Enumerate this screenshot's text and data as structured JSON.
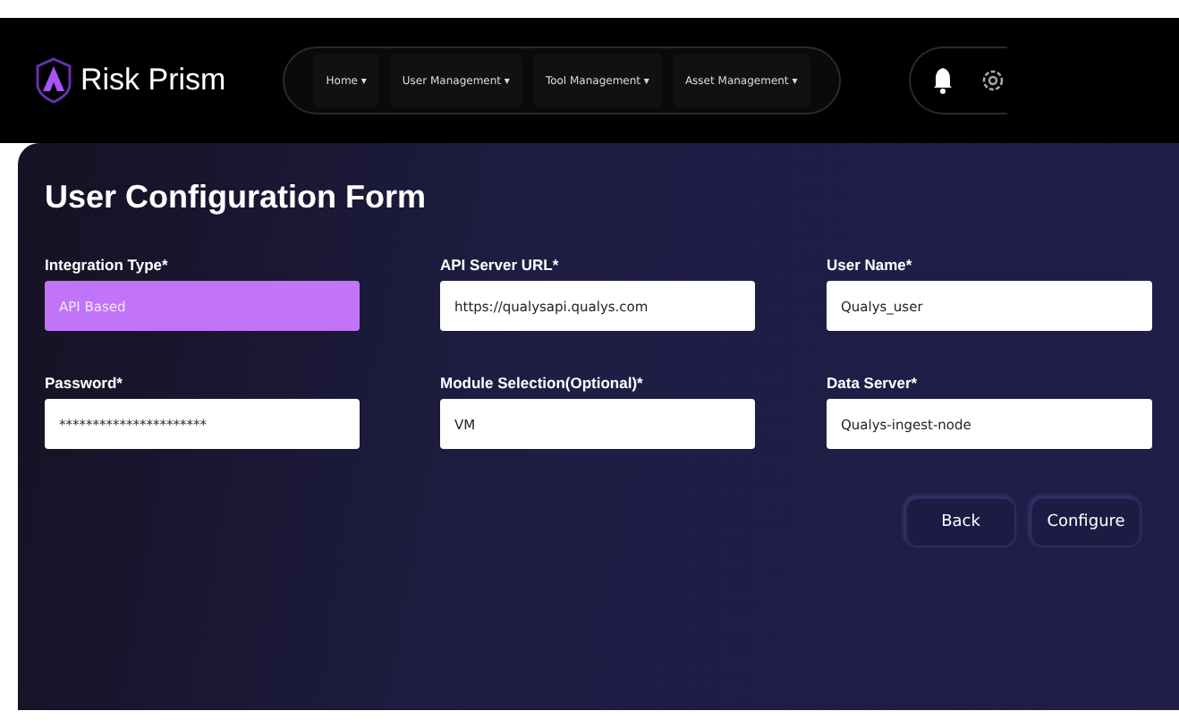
{
  "header": {
    "brand": "Risk Prism",
    "nav": [
      {
        "label": "Home ▾"
      },
      {
        "label": "User Management ▾"
      },
      {
        "label": "Tool Management ▾"
      },
      {
        "label": "Asset Management ▾"
      }
    ]
  },
  "form": {
    "title": "User Configuration Form",
    "fields": [
      {
        "label": "Integration Type*",
        "value": "API Based",
        "highlighted": true
      },
      {
        "label": "API Server URL*",
        "value": "https://qualysapi.qualys.com",
        "highlighted": false
      },
      {
        "label": "User Name*",
        "value": "Qualys_user",
        "highlighted": false
      },
      {
        "label": "Password*",
        "value": "**********************",
        "highlighted": false
      },
      {
        "label": "Module Selection(Optional)*",
        "value": "VM",
        "highlighted": false
      },
      {
        "label": "Data Server*",
        "value": "Qualys-ingest-node",
        "highlighted": false
      }
    ],
    "buttons": [
      "Back",
      "Configure"
    ]
  }
}
